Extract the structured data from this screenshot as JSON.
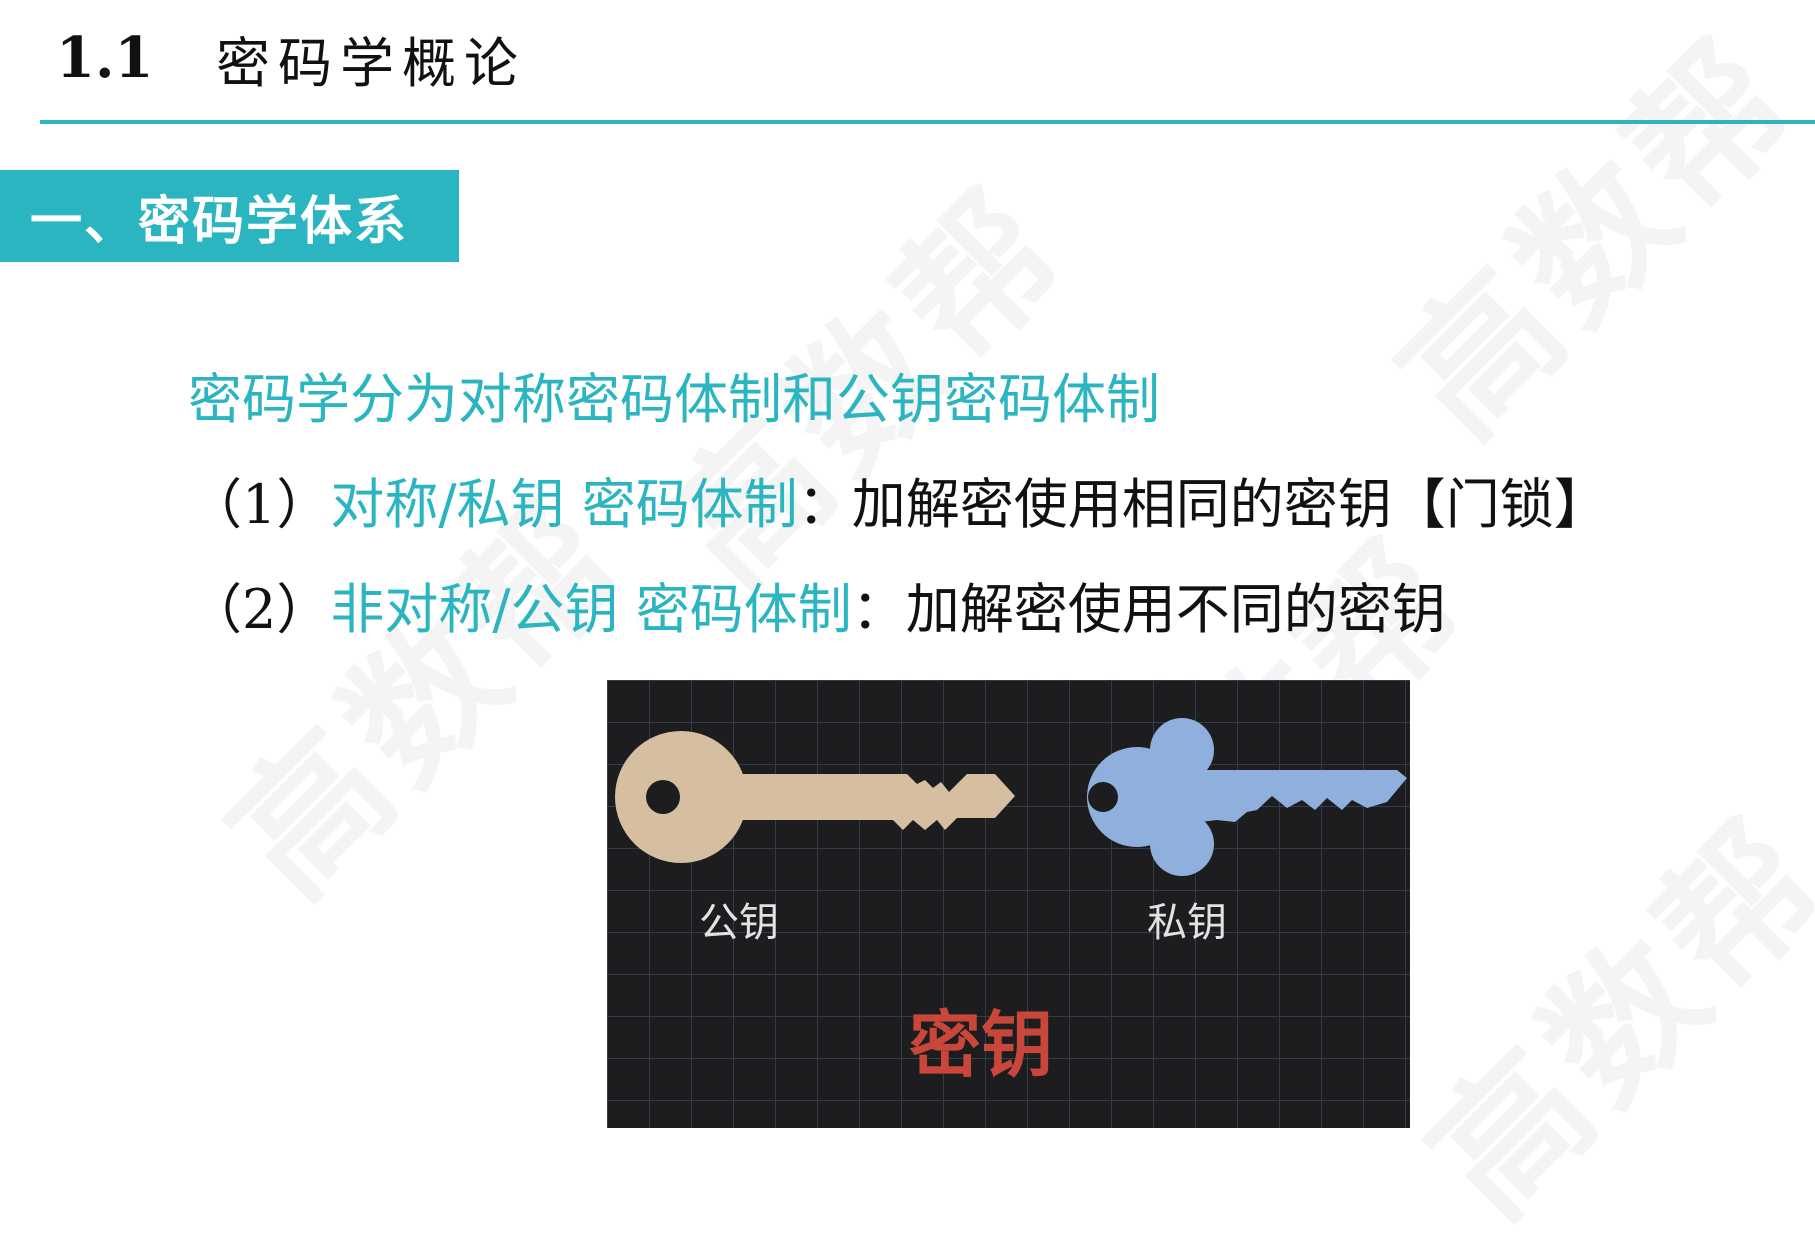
{
  "header": {
    "section_number": "1.1",
    "section_title": "密码学概论"
  },
  "subsection": {
    "label": "一、密码学体系"
  },
  "intro": "密码学分为对称密码体制和公钥密码体制",
  "items": [
    {
      "number": "（1）",
      "term": "对称/私钥 密码体制",
      "colon": "：",
      "description": "加解密使用相同的密钥【门锁】"
    },
    {
      "number": "（2）",
      "term": "非对称/公钥 密码体制",
      "colon": "：",
      "description": "加解密使用不同的密钥"
    }
  ],
  "key_image": {
    "public_key_label": "公钥",
    "private_key_label": "私钥",
    "caption": "密钥",
    "colors": {
      "background": "#1d1d1f",
      "grid": "#2f3e4a",
      "public_key": "#d6bfa0",
      "private_key": "#8fb0dc",
      "caption": "#c9473a"
    }
  },
  "watermark": "高数帮",
  "colors": {
    "accent": "#2ab5c0",
    "text": "#111111"
  }
}
